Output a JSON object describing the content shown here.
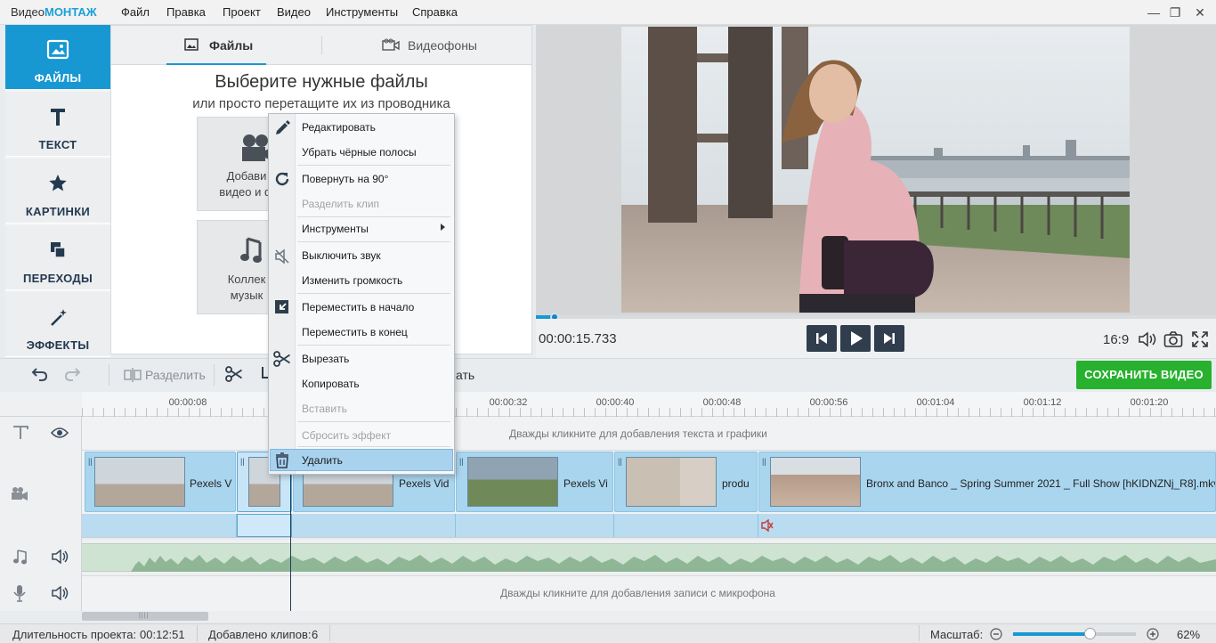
{
  "app": {
    "brand_prefix": "Видео",
    "brand_suffix": "МОНТАЖ"
  },
  "menu": [
    "Файл",
    "Правка",
    "Проект",
    "Видео",
    "Инструменты",
    "Справка"
  ],
  "window_controls": {
    "minimize": "—",
    "maximize": "❐",
    "close": "✕"
  },
  "sidebar": {
    "items": [
      {
        "label": "ФАЙЛЫ",
        "icon": "image-icon",
        "active": true
      },
      {
        "label": "ТЕКСТ",
        "icon": "text-t-icon",
        "active": false
      },
      {
        "label": "КАРТИНКИ",
        "icon": "star-icon",
        "active": false
      },
      {
        "label": "ПЕРЕХОДЫ",
        "icon": "transitions-icon",
        "active": false
      },
      {
        "label": "ЭФФЕКТЫ",
        "icon": "magic-wand-icon",
        "active": false
      }
    ]
  },
  "files_panel": {
    "tabs": [
      {
        "label": "Файлы",
        "icon": "image-icon",
        "active": true
      },
      {
        "label": "Видеофоны",
        "icon": "video-camera-icon",
        "active": false
      }
    ],
    "title": "Выберите нужные файлы",
    "subtitle": "или просто перетащите их из проводника",
    "card_add": {
      "line1": "Добави",
      "line2": "видео и ф"
    },
    "card_music": {
      "line1": "Коллек",
      "line2": "музык"
    }
  },
  "preview": {
    "time": "00:00:15.733",
    "aspect": "16:9",
    "progress_fraction": 0.028
  },
  "toolbar": {
    "split_label": "Разделить",
    "partial_label": "ать",
    "save_label": "СОХРАНИТЬ ВИДЕО"
  },
  "timeline": {
    "ruler": [
      "00:00:08",
      "00:00:32",
      "00:00:40",
      "00:00:48",
      "00:00:56",
      "00:01:04",
      "00:01:12",
      "00:01:20"
    ],
    "text_hint": "Дважды кликните для добавления текста и графики",
    "mic_hint": "Дважды кликните для добавления записи с микрофона",
    "clips": [
      {
        "name": "Pexels V"
      },
      {
        "name": ""
      },
      {
        "name": "Pexels Vid"
      },
      {
        "name": "Pexels Vi"
      },
      {
        "name": "produ"
      },
      {
        "name": "Bronx and Banco _ Spring Summer 2021 _ Full Show [hKIDNZNj_R8].mkv"
      }
    ]
  },
  "context_menu": {
    "items": [
      {
        "label": "Редактировать",
        "disabled": false,
        "icon": "pencil-icon"
      },
      {
        "label": "Убрать чёрные полосы",
        "disabled": false
      },
      {
        "label": "Повернуть на 90°",
        "disabled": false,
        "icon": "rotate-icon"
      },
      {
        "label": "Разделить клип",
        "disabled": true
      },
      {
        "label": "Инструменты",
        "disabled": false,
        "submenu": true
      },
      {
        "label": "Выключить звук",
        "disabled": false,
        "icon": "mute-icon"
      },
      {
        "label": "Изменить громкость",
        "disabled": false
      },
      {
        "label": "Переместить в начало",
        "disabled": false,
        "icon": "move-icon"
      },
      {
        "label": "Переместить в конец",
        "disabled": false
      },
      {
        "label": "Вырезать",
        "disabled": false,
        "icon": "scissors-icon"
      },
      {
        "label": "Копировать",
        "disabled": false
      },
      {
        "label": "Вставить",
        "disabled": true
      },
      {
        "label": "Сбросить эффект",
        "disabled": true
      },
      {
        "label": "Удалить",
        "disabled": false,
        "icon": "trash-icon",
        "highlighted": true
      }
    ]
  },
  "status": {
    "duration_label": "Длительность проекта:",
    "duration_value": "00:12:51",
    "clips_label": "Добавлено клипов:",
    "clips_value": "6",
    "scale_label": "Масштаб:",
    "zoom_fraction": 0.62,
    "zoom_percent": "62%"
  },
  "colors": {
    "accent": "#1798d3",
    "save_button": "#27b12e",
    "clip": "#a9d5ee",
    "dark_button": "#2f3d4d"
  }
}
